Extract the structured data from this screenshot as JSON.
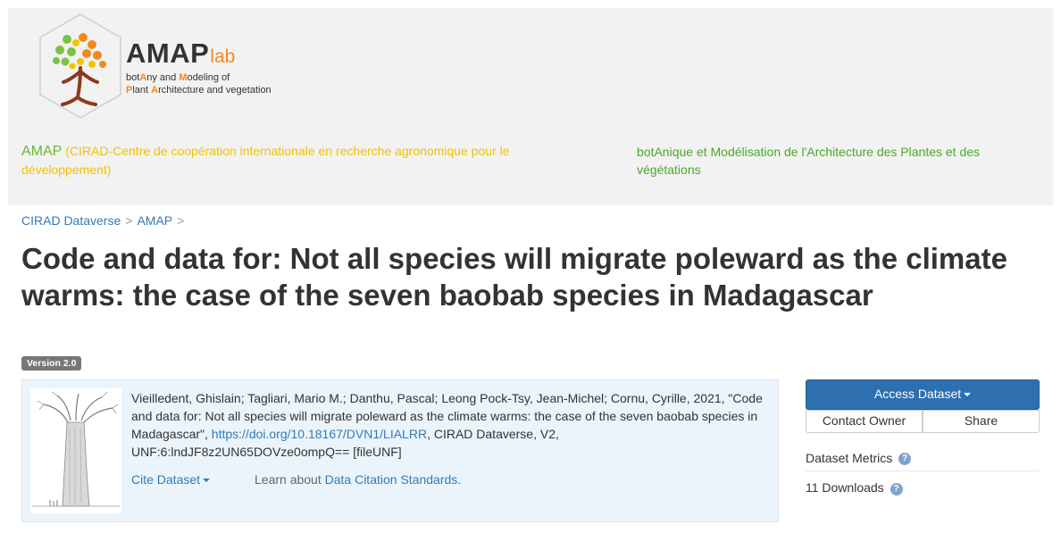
{
  "banner": {
    "brand_main": "AMAP",
    "brand_lab": "lab",
    "tagline_line1_prefix": "bot",
    "tagline_line1_a": "A",
    "tagline_line1_mid": "ny and ",
    "tagline_line1_m": "M",
    "tagline_line1_suffix": "odeling of",
    "tagline_line2_p": "P",
    "tagline_line2_mid": "lant ",
    "tagline_line2_a": "A",
    "tagline_line2_suffix": "rchitecture and vegetation",
    "affiliation_acronym": "AMAP",
    "affiliation_text": "(CIRAD-Centre de coopération internationale en recherche agronomique pour le développement)",
    "affiliation_right": "botAnique et Modélisation de l'Architecture des Plantes et des végétations"
  },
  "breadcrumb": {
    "items": [
      "CIRAD Dataverse",
      "AMAP"
    ],
    "separator": ">"
  },
  "title": "Code and data for: Not all species will migrate poleward as the climate warms: the case of the seven baobab species in Madagascar",
  "version_badge": "Version 2.0",
  "citation": {
    "text_before": "Vieilledent, Ghislain; Tagliari, Mario M.; Danthu, Pascal; Leong Pock-Tsy, Jean-Michel; Cornu, Cyrille, 2021, \"Code and data for: Not all species will migrate poleward as the climate warms: the case of the seven baobab species in Madagascar\", ",
    "doi": "https://doi.org/10.18167/DVN1/LIALRR",
    "text_after": ", CIRAD Dataverse, V2, UNF:6:lndJF8z2UN65DOVze0ompQ== [fileUNF]",
    "cite_button": "Cite Dataset",
    "learn_prefix": "Learn about",
    "learn_link": "Data Citation Standards."
  },
  "actions": {
    "access": "Access Dataset",
    "contact": "Contact Owner",
    "share": "Share"
  },
  "metrics": {
    "label": "Dataset Metrics",
    "downloads": "11 Downloads",
    "help_glyph": "?"
  },
  "colors": {
    "brand_orange": "#f08a1c",
    "affiliation_yellow": "#f2c200",
    "affiliation_green": "#4aa82a",
    "link_blue": "#337ab7",
    "primary_button": "#2e6fb0",
    "citation_bg": "#ebf4fb"
  }
}
